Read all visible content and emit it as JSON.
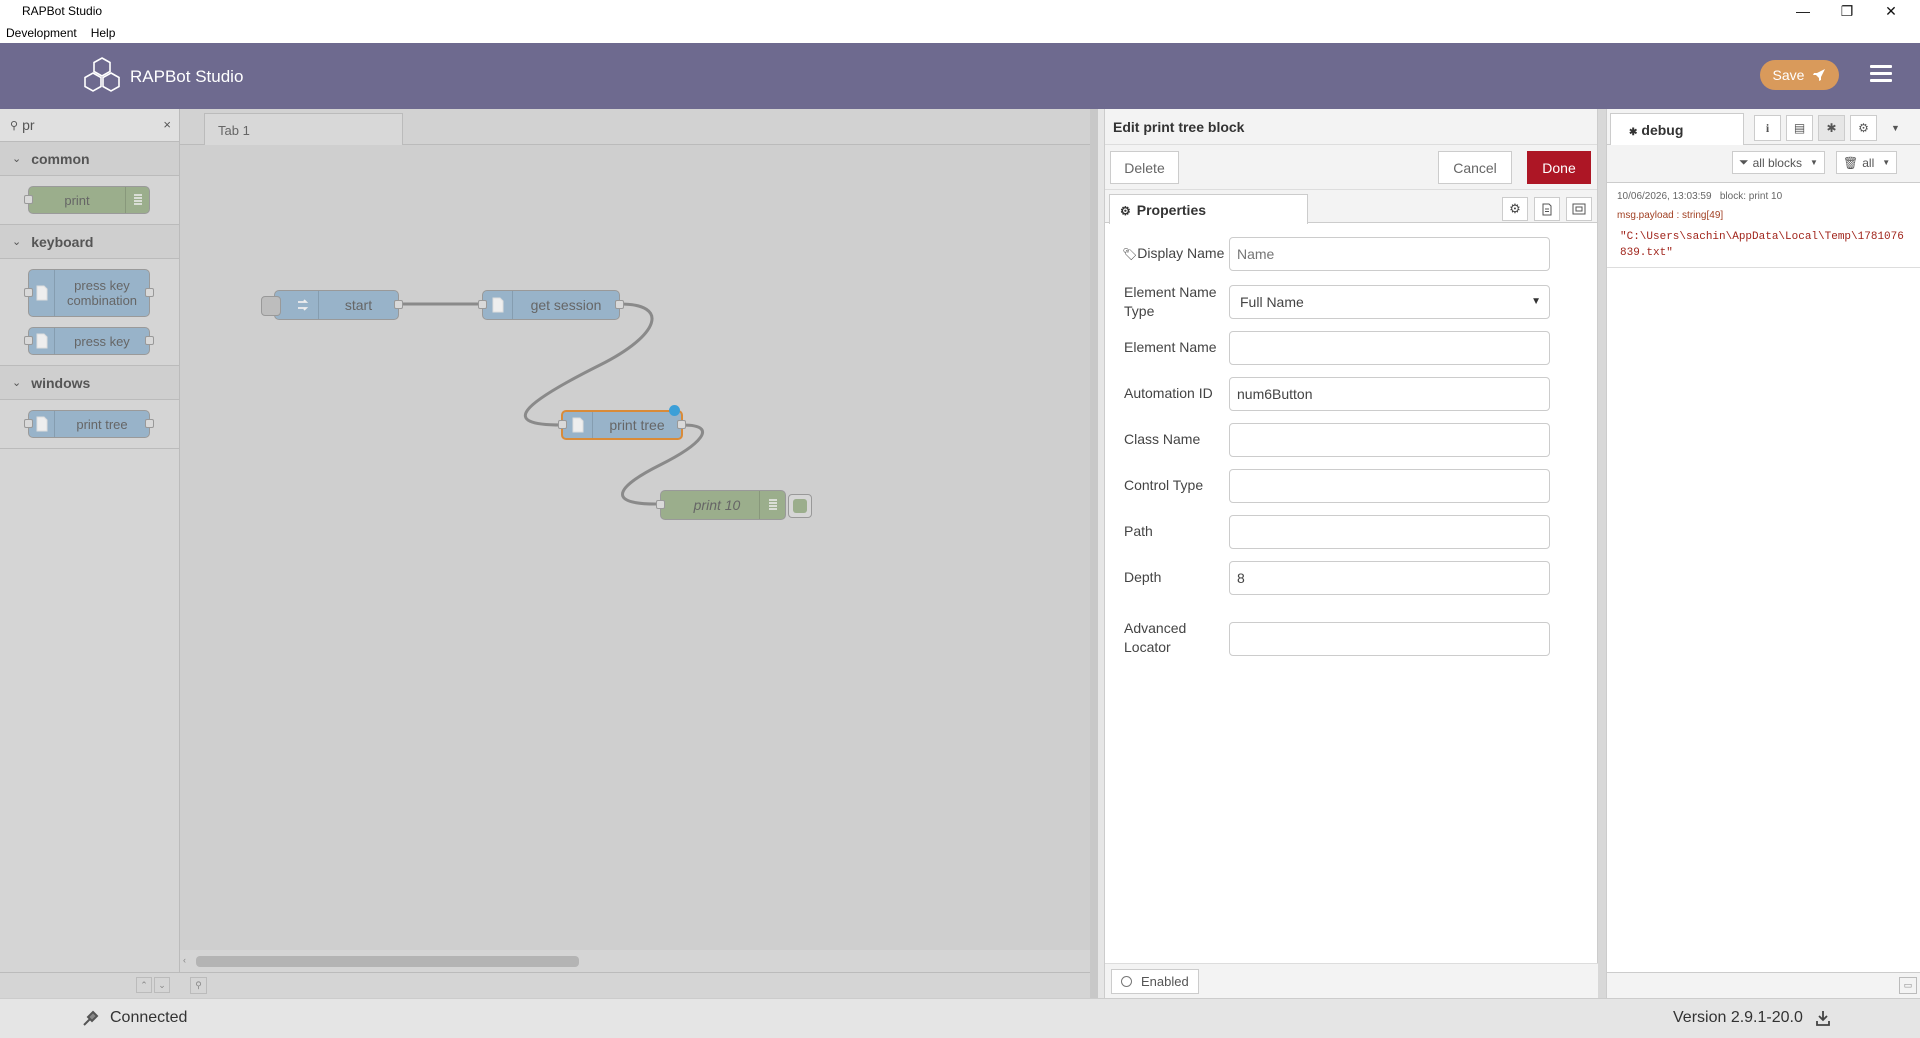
{
  "window": {
    "title": "RAPBot Studio",
    "controls": {
      "minimize": "—",
      "maximize": "❐",
      "close": "✕"
    }
  },
  "menu": [
    "Development",
    "Help"
  ],
  "header": {
    "app_name": "RAPBot Studio",
    "save_label": "Save",
    "brand_color": "#6e6a8f",
    "save_color": "#d99a5b"
  },
  "palette": {
    "search_value": "pr",
    "clear_icon": "×",
    "categories": [
      {
        "name": "common",
        "nodes": [
          {
            "label": "print",
            "color": "green"
          }
        ]
      },
      {
        "name": "keyboard",
        "nodes": [
          {
            "label": "press key combination",
            "line1": "press key",
            "line2": "combination",
            "color": "blue"
          },
          {
            "label": "press key",
            "color": "blue"
          }
        ]
      },
      {
        "name": "windows",
        "nodes": [
          {
            "label": "print tree",
            "color": "blue"
          }
        ]
      }
    ]
  },
  "workspace": {
    "tab": "Tab 1",
    "nodes": {
      "start": "start",
      "get_session": "get session",
      "print_tree": "print tree",
      "print_10": "print 10"
    }
  },
  "editor": {
    "title": "Edit print tree block",
    "delete_label": "Delete",
    "cancel_label": "Cancel",
    "done_label": "Done",
    "properties_tab": "Properties",
    "fields": {
      "display_name": {
        "label": "Display Name",
        "value": "",
        "placeholder": "Name"
      },
      "element_name_type": {
        "label_1": "Element Name",
        "label_2": "Type",
        "value": "Full Name"
      },
      "element_name": {
        "label": "Element Name",
        "value": ""
      },
      "automation_id": {
        "label": "Automation ID",
        "value": "num6Button"
      },
      "class_name": {
        "label": "Class Name",
        "value": ""
      },
      "control_type": {
        "label": "Control Type",
        "value": ""
      },
      "path": {
        "label": "Path",
        "value": ""
      },
      "depth": {
        "label": "Depth",
        "value": "8"
      },
      "advanced_locator": {
        "label_1": "Advanced",
        "label_2": "Locator",
        "value": ""
      }
    },
    "enabled_label": "Enabled",
    "done_color": "#ad1625"
  },
  "debug": {
    "tab_label": "debug",
    "filter_label": "all blocks",
    "clear_label": "all",
    "message": {
      "timestamp": "10/06/2026, 13:03:59",
      "source": "block: print 10",
      "meta": "msg.payload : string[49]",
      "value": "\"C:\\Users\\sachin\\AppData\\Local\\Temp\\1781076839.txt\""
    }
  },
  "status": {
    "connection": "Connected",
    "version": "Version 2.9.1-20.0"
  }
}
